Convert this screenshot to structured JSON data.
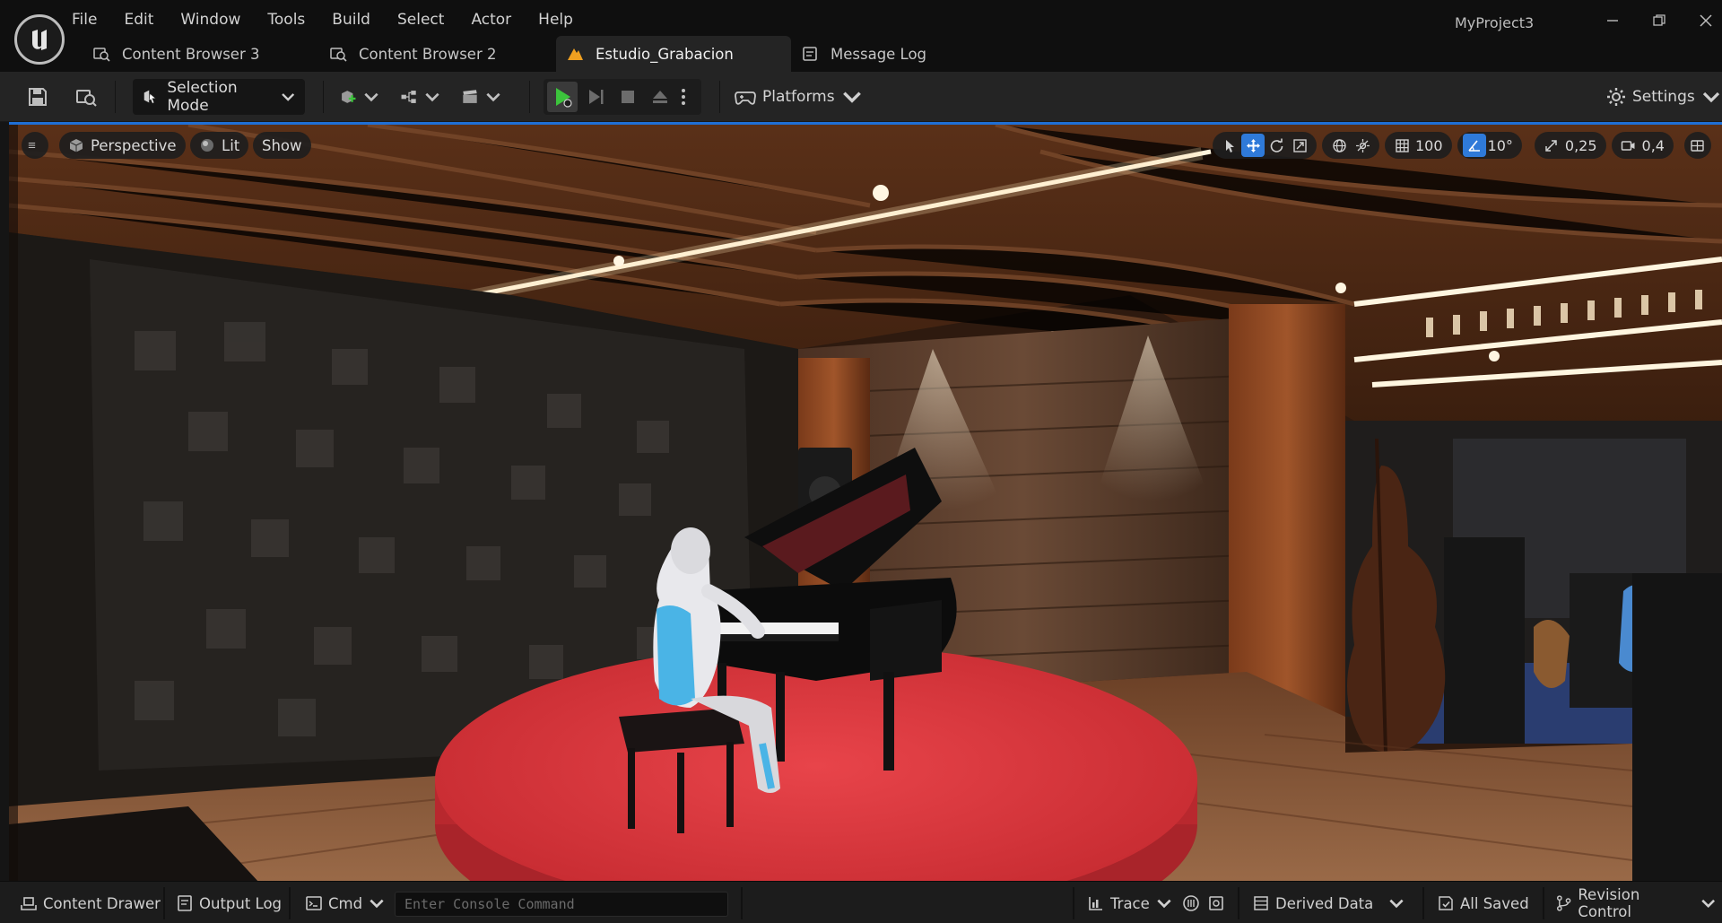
{
  "app": {
    "project_name": "MyProject3"
  },
  "menu": {
    "items": [
      "File",
      "Edit",
      "Window",
      "Tools",
      "Build",
      "Select",
      "Actor",
      "Help"
    ]
  },
  "tabs": [
    {
      "label": "Content Browser 3",
      "icon": "content-browser-icon",
      "active": false
    },
    {
      "label": "Content Browser 2",
      "icon": "content-browser-icon",
      "active": false
    },
    {
      "label": "Estudio_Grabacion",
      "icon": "level-icon",
      "active": true
    },
    {
      "label": "Message Log",
      "icon": "message-log-icon",
      "active": false
    }
  ],
  "toolbar": {
    "selection_mode": "Selection Mode",
    "platforms": "Platforms",
    "settings": "Settings"
  },
  "viewport": {
    "perspective": "Perspective",
    "lit": "Lit",
    "show": "Show",
    "grid_snap": "100",
    "rotation_snap": "10°",
    "scale_snap": "0,25",
    "camera_speed": "0,4"
  },
  "statusbar": {
    "content_drawer": "Content Drawer",
    "output_log": "Output Log",
    "cmd": "Cmd",
    "console_placeholder": "Enter Console Command",
    "trace": "Trace",
    "derived_data": "Derived Data",
    "all_saved": "All Saved",
    "revision_control": "Revision Control"
  },
  "colors": {
    "accent_blue": "#2f7ad9",
    "play_green": "#3cc43c",
    "stage_red": "#d9363a"
  }
}
